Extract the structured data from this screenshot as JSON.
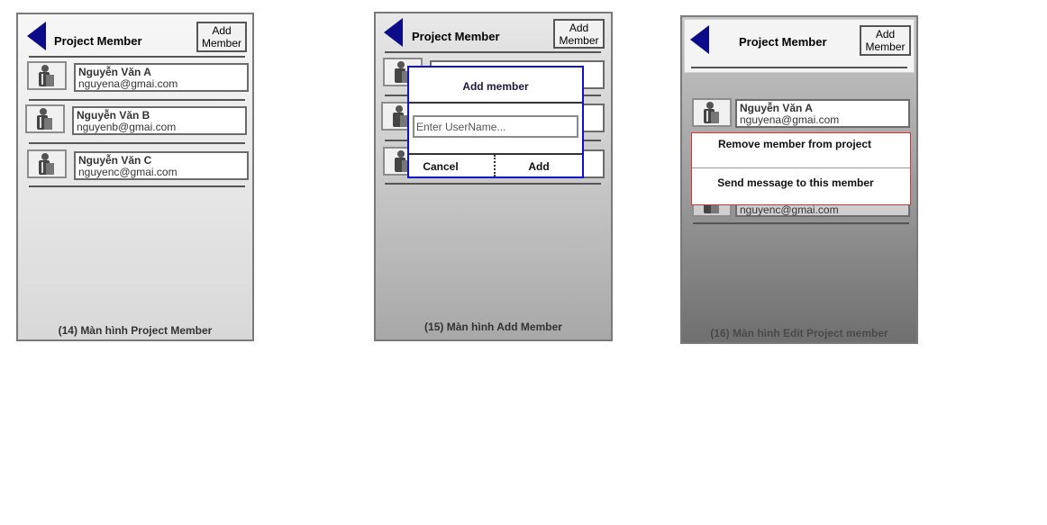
{
  "screens": [
    {
      "header": {
        "title": "Project Member",
        "add_line1": "Add",
        "add_line2": "Member"
      },
      "members": [
        {
          "name": "Nguyễn Văn A",
          "email": "nguyena@gmai.com"
        },
        {
          "name": "Nguyễn Văn B",
          "email": "nguyenb@gmai.com"
        },
        {
          "name": "Nguyễn Văn C",
          "email": "nguyenc@gmai.com"
        }
      ],
      "caption": "(14) Màn hình Project Member"
    },
    {
      "header": {
        "title": "Project Member",
        "add_line1": "Add",
        "add_line2": "Member"
      },
      "dialog": {
        "title": "Add member",
        "placeholder": "Enter UserName...",
        "cancel": "Cancel",
        "add": "Add"
      },
      "caption": "(15) Màn hình Add Member"
    },
    {
      "header": {
        "title": "Project Member",
        "add_line1": "Add",
        "add_line2": "Member"
      },
      "members": [
        {
          "name": "Nguyễn Văn A",
          "email": "nguyena@gmai.com"
        },
        {
          "email": "nguyenc@gmai.com"
        }
      ],
      "menu": {
        "remove": "Remove member from project",
        "message": "Send message to this member"
      },
      "caption": "(16) Màn hình Edit Project member"
    }
  ]
}
